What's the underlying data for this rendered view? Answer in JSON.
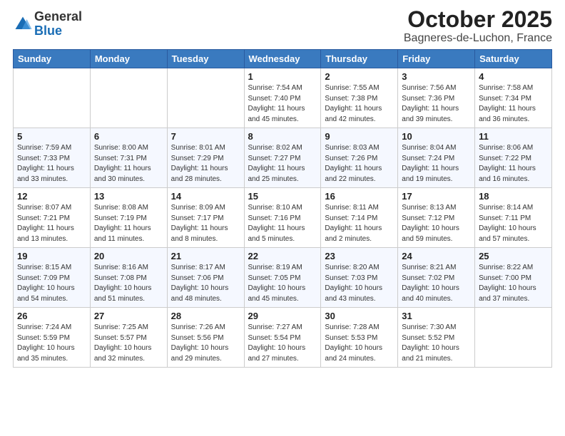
{
  "logo": {
    "general": "General",
    "blue": "Blue"
  },
  "title": "October 2025",
  "subtitle": "Bagneres-de-Luchon, France",
  "weekdays": [
    "Sunday",
    "Monday",
    "Tuesday",
    "Wednesday",
    "Thursday",
    "Friday",
    "Saturday"
  ],
  "weeks": [
    [
      {
        "day": "",
        "info": ""
      },
      {
        "day": "",
        "info": ""
      },
      {
        "day": "",
        "info": ""
      },
      {
        "day": "1",
        "info": "Sunrise: 7:54 AM\nSunset: 7:40 PM\nDaylight: 11 hours and 45 minutes."
      },
      {
        "day": "2",
        "info": "Sunrise: 7:55 AM\nSunset: 7:38 PM\nDaylight: 11 hours and 42 minutes."
      },
      {
        "day": "3",
        "info": "Sunrise: 7:56 AM\nSunset: 7:36 PM\nDaylight: 11 hours and 39 minutes."
      },
      {
        "day": "4",
        "info": "Sunrise: 7:58 AM\nSunset: 7:34 PM\nDaylight: 11 hours and 36 minutes."
      }
    ],
    [
      {
        "day": "5",
        "info": "Sunrise: 7:59 AM\nSunset: 7:33 PM\nDaylight: 11 hours and 33 minutes."
      },
      {
        "day": "6",
        "info": "Sunrise: 8:00 AM\nSunset: 7:31 PM\nDaylight: 11 hours and 30 minutes."
      },
      {
        "day": "7",
        "info": "Sunrise: 8:01 AM\nSunset: 7:29 PM\nDaylight: 11 hours and 28 minutes."
      },
      {
        "day": "8",
        "info": "Sunrise: 8:02 AM\nSunset: 7:27 PM\nDaylight: 11 hours and 25 minutes."
      },
      {
        "day": "9",
        "info": "Sunrise: 8:03 AM\nSunset: 7:26 PM\nDaylight: 11 hours and 22 minutes."
      },
      {
        "day": "10",
        "info": "Sunrise: 8:04 AM\nSunset: 7:24 PM\nDaylight: 11 hours and 19 minutes."
      },
      {
        "day": "11",
        "info": "Sunrise: 8:06 AM\nSunset: 7:22 PM\nDaylight: 11 hours and 16 minutes."
      }
    ],
    [
      {
        "day": "12",
        "info": "Sunrise: 8:07 AM\nSunset: 7:21 PM\nDaylight: 11 hours and 13 minutes."
      },
      {
        "day": "13",
        "info": "Sunrise: 8:08 AM\nSunset: 7:19 PM\nDaylight: 11 hours and 11 minutes."
      },
      {
        "day": "14",
        "info": "Sunrise: 8:09 AM\nSunset: 7:17 PM\nDaylight: 11 hours and 8 minutes."
      },
      {
        "day": "15",
        "info": "Sunrise: 8:10 AM\nSunset: 7:16 PM\nDaylight: 11 hours and 5 minutes."
      },
      {
        "day": "16",
        "info": "Sunrise: 8:11 AM\nSunset: 7:14 PM\nDaylight: 11 hours and 2 minutes."
      },
      {
        "day": "17",
        "info": "Sunrise: 8:13 AM\nSunset: 7:12 PM\nDaylight: 10 hours and 59 minutes."
      },
      {
        "day": "18",
        "info": "Sunrise: 8:14 AM\nSunset: 7:11 PM\nDaylight: 10 hours and 57 minutes."
      }
    ],
    [
      {
        "day": "19",
        "info": "Sunrise: 8:15 AM\nSunset: 7:09 PM\nDaylight: 10 hours and 54 minutes."
      },
      {
        "day": "20",
        "info": "Sunrise: 8:16 AM\nSunset: 7:08 PM\nDaylight: 10 hours and 51 minutes."
      },
      {
        "day": "21",
        "info": "Sunrise: 8:17 AM\nSunset: 7:06 PM\nDaylight: 10 hours and 48 minutes."
      },
      {
        "day": "22",
        "info": "Sunrise: 8:19 AM\nSunset: 7:05 PM\nDaylight: 10 hours and 45 minutes."
      },
      {
        "day": "23",
        "info": "Sunrise: 8:20 AM\nSunset: 7:03 PM\nDaylight: 10 hours and 43 minutes."
      },
      {
        "day": "24",
        "info": "Sunrise: 8:21 AM\nSunset: 7:02 PM\nDaylight: 10 hours and 40 minutes."
      },
      {
        "day": "25",
        "info": "Sunrise: 8:22 AM\nSunset: 7:00 PM\nDaylight: 10 hours and 37 minutes."
      }
    ],
    [
      {
        "day": "26",
        "info": "Sunrise: 7:24 AM\nSunset: 5:59 PM\nDaylight: 10 hours and 35 minutes."
      },
      {
        "day": "27",
        "info": "Sunrise: 7:25 AM\nSunset: 5:57 PM\nDaylight: 10 hours and 32 minutes."
      },
      {
        "day": "28",
        "info": "Sunrise: 7:26 AM\nSunset: 5:56 PM\nDaylight: 10 hours and 29 minutes."
      },
      {
        "day": "29",
        "info": "Sunrise: 7:27 AM\nSunset: 5:54 PM\nDaylight: 10 hours and 27 minutes."
      },
      {
        "day": "30",
        "info": "Sunrise: 7:28 AM\nSunset: 5:53 PM\nDaylight: 10 hours and 24 minutes."
      },
      {
        "day": "31",
        "info": "Sunrise: 7:30 AM\nSunset: 5:52 PM\nDaylight: 10 hours and 21 minutes."
      },
      {
        "day": "",
        "info": ""
      }
    ]
  ]
}
